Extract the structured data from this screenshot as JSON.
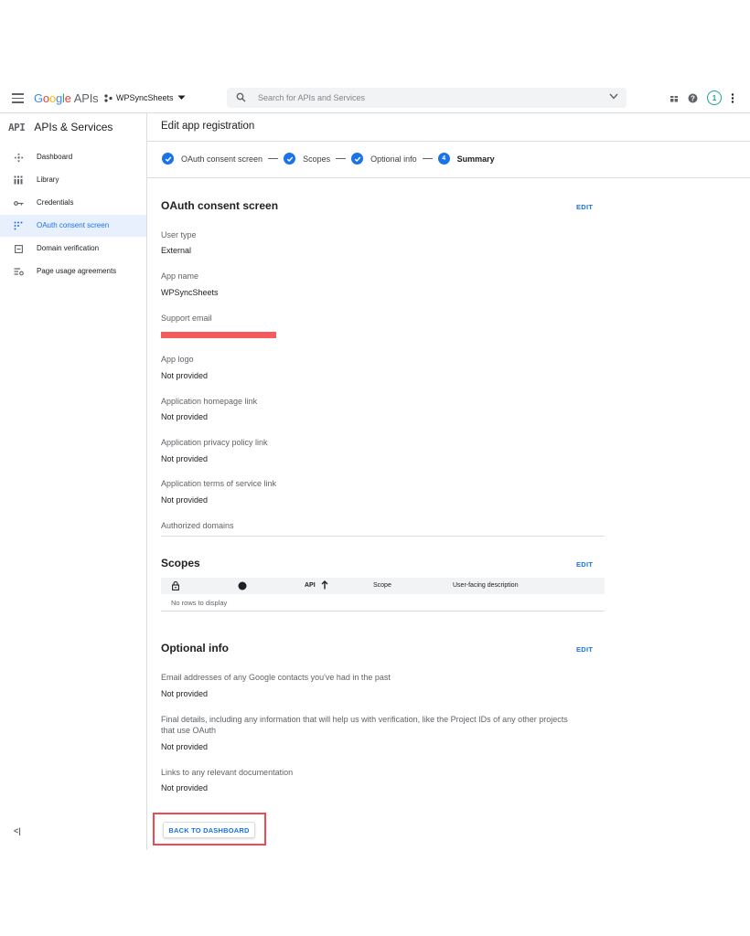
{
  "topbar": {
    "logo": "Google",
    "logo_suffix": "APIs",
    "project_name": "WPSyncSheets",
    "search_placeholder": "Search for APIs and Services",
    "avatar_initial": "1"
  },
  "sidebar": {
    "api_badge": "API",
    "title": "APIs & Services",
    "items": [
      {
        "label": "Dashboard",
        "icon": "dashboard-icon"
      },
      {
        "label": "Library",
        "icon": "library-icon"
      },
      {
        "label": "Credentials",
        "icon": "key-icon"
      },
      {
        "label": "OAuth consent screen",
        "icon": "consent-icon",
        "active": true
      },
      {
        "label": "Domain verification",
        "icon": "domain-icon"
      },
      {
        "label": "Page usage agreements",
        "icon": "settings-list-icon"
      }
    ],
    "collapse": "<|"
  },
  "main": {
    "title": "Edit app registration",
    "steps": [
      {
        "label": "OAuth consent screen",
        "state": "done"
      },
      {
        "label": "Scopes",
        "state": "done"
      },
      {
        "label": "Optional info",
        "state": "done"
      },
      {
        "label": "Summary",
        "state": "current",
        "number": "4"
      }
    ],
    "oauth": {
      "title": "OAuth consent screen",
      "edit": "EDIT",
      "fields": [
        {
          "label": "User type",
          "value": "External"
        },
        {
          "label": "App name",
          "value": "WPSyncSheets"
        },
        {
          "label": "Support email",
          "value": ""
        },
        {
          "label": "App logo",
          "value": "Not provided"
        },
        {
          "label": "Application homepage link",
          "value": "Not provided"
        },
        {
          "label": "Application privacy policy link",
          "value": "Not provided"
        },
        {
          "label": "Application terms of service link",
          "value": "Not provided"
        },
        {
          "label": "Authorized domains",
          "value": ""
        }
      ]
    },
    "scopes": {
      "title": "Scopes",
      "edit": "EDIT",
      "columns": [
        "API",
        "Scope",
        "User-facing description"
      ],
      "empty": "No rows to display"
    },
    "optional": {
      "title": "Optional info",
      "edit": "EDIT",
      "fields": [
        {
          "label": "Email addresses of any Google contacts you've had in the past",
          "value": "Not provided"
        },
        {
          "label_line1": "Final details, including any information that will help us with verification, like the Project IDs of any other projects",
          "label_line2": "that use OAuth",
          "value": "Not provided"
        },
        {
          "label": "Links to any relevant documentation",
          "value": "Not provided"
        }
      ]
    },
    "back_button": "BACK TO DASHBOARD"
  },
  "colors": {
    "accent": "#1a73e8",
    "highlight": "#ee4a53",
    "redaction": "#f45b5b",
    "avatar": "#1aa39a"
  }
}
